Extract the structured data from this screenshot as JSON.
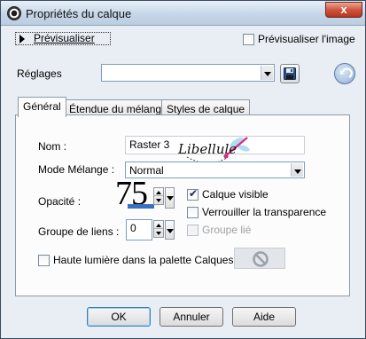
{
  "window": {
    "title": "Propriétés du calque",
    "close_label": "x"
  },
  "top": {
    "preview_button_label": "Prévisualiser",
    "preview_image_label": "Prévisualiser l'image",
    "preview_image_checked": false,
    "presets_label": "Réglages",
    "presets_value": ""
  },
  "tabs": [
    {
      "label": "Général",
      "active": true
    },
    {
      "label": "Étendue du mélange",
      "active": false
    },
    {
      "label": "Styles de calque",
      "active": false
    }
  ],
  "general": {
    "name_label": "Nom :",
    "name_value": "Raster 3",
    "blend_mode_label": "Mode Mélange :",
    "blend_mode_value": "Normal",
    "opacity_label": "Opacité :",
    "opacity_value": "75",
    "visible_label": "Calque visible",
    "visible_checked": true,
    "lock_transparency_label": "Verrouiller la transparence",
    "lock_transparency_checked": false,
    "link_group_label": "Groupe de liens :",
    "link_group_value": "0",
    "group_linked_label": "Groupe lié",
    "group_linked_enabled": false,
    "highlight_label": "Haute lumière dans la palette Calques :",
    "highlight_checked": false
  },
  "buttons": {
    "ok": "OK",
    "cancel": "Annuler",
    "help": "Aide"
  },
  "watermark": {
    "text": "Libellule"
  },
  "colors": {
    "accent": "#3a6ec0",
    "watermark_pink": "#e0287a"
  }
}
